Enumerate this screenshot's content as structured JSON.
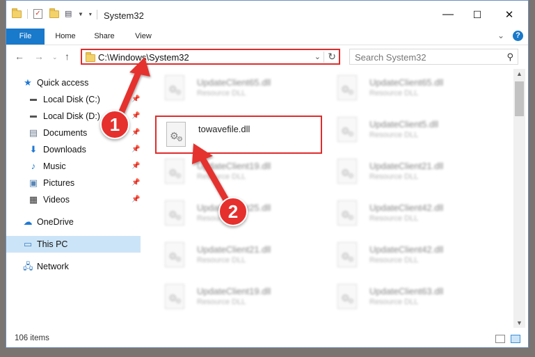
{
  "window": {
    "title": "System32",
    "controls": {
      "minimize": "—",
      "maximize": "☐",
      "close": "✕"
    }
  },
  "ribbon": {
    "tabs": [
      {
        "label": "File"
      },
      {
        "label": "Home"
      },
      {
        "label": "Share"
      },
      {
        "label": "View"
      }
    ],
    "help": "?"
  },
  "nav": {
    "address": "C:\\Windows\\System32",
    "search_placeholder": "Search System32"
  },
  "sidebar": {
    "items": [
      {
        "label": "Quick access",
        "icon": "star-icon"
      },
      {
        "label": "Local Disk (C:)",
        "icon": "drive-icon",
        "pinned": true
      },
      {
        "label": "Local Disk (D:)",
        "icon": "drive-icon",
        "pinned": true
      },
      {
        "label": "Documents",
        "icon": "documents-icon",
        "pinned": true
      },
      {
        "label": "Downloads",
        "icon": "downloads-icon",
        "pinned": true
      },
      {
        "label": "Music",
        "icon": "music-icon",
        "pinned": true
      },
      {
        "label": "Pictures",
        "icon": "pictures-icon",
        "pinned": true
      },
      {
        "label": "Videos",
        "icon": "videos-icon",
        "pinned": true
      },
      {
        "label": "OneDrive",
        "icon": "onedrive-icon"
      },
      {
        "label": "This PC",
        "icon": "pc-icon",
        "selected": true
      },
      {
        "label": "Network",
        "icon": "network-icon"
      }
    ]
  },
  "files": {
    "type_label": "Resource DLL",
    "left": [
      {
        "name": "UpdateClient65.dll"
      },
      {
        "name": "towavefile.dll"
      },
      {
        "name": "UpdateClient19.dll"
      },
      {
        "name": "UpdateClient25.dll"
      },
      {
        "name": "UpdateClient21.dll"
      },
      {
        "name": "UpdateClient19.dll"
      }
    ],
    "right": [
      {
        "name": "UpdateClient65.dll"
      },
      {
        "name": "UpdateClient5.dll"
      },
      {
        "name": "UpdateClient21.dll"
      },
      {
        "name": "UpdateClient42.dll"
      },
      {
        "name": "UpdateClient42.dll"
      },
      {
        "name": "UpdateClient63.dll"
      }
    ]
  },
  "status": {
    "items_count": "106 items"
  },
  "annotations": {
    "step1": "1",
    "step2": "2",
    "accent_color": "#e5302e"
  }
}
